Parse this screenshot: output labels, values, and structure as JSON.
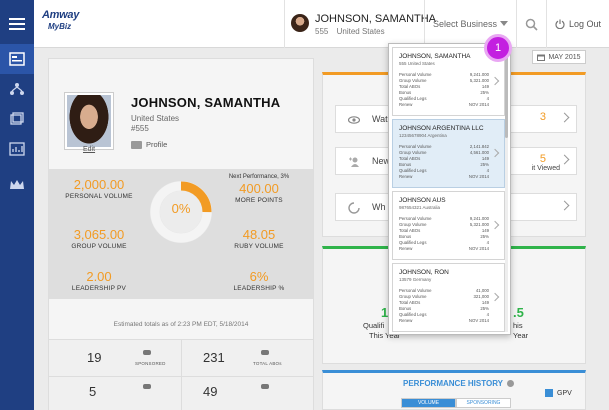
{
  "brand": {
    "name": "Amway",
    "sub": "MyBiz"
  },
  "header": {
    "user_name": "JOHNSON, SAMANTHA",
    "user_num": "555",
    "user_country": "United States",
    "select_business": "Select Business",
    "logout": "Log Out"
  },
  "date_badge": "MAY 2015",
  "callout": "1",
  "profile": {
    "name": "JOHNSON, SAMANTHA",
    "country": "United States",
    "id": "#555",
    "edit": "Edit",
    "profile_link": "Profile"
  },
  "stats": {
    "personal_volume": {
      "value": "2,000.00",
      "label": "PERSONAL VOLUME"
    },
    "group_volume": {
      "value": "3,065.00",
      "label": "GROUP VOLUME"
    },
    "leadership_pv": {
      "value": "2.00",
      "label": "LEADERSHIP PV"
    },
    "next_performance": "Next Performance, 3%",
    "more_points": {
      "value": "400.00",
      "label": "MORE POINTS"
    },
    "ruby_volume": {
      "value": "48.05",
      "label": "RUBY VOLUME"
    },
    "leadership_pct": {
      "value": "6%",
      "label": "LEADERSHIP %"
    },
    "progress_pct": "0%",
    "progress_fraction": 0.25,
    "estimated": "Estimated totals as of 2:23 PM EDT, 5/18/2014"
  },
  "counts": [
    {
      "value": "19",
      "label": "SPONSORED"
    },
    {
      "value": "231",
      "label": "TOTAL ABOs"
    },
    {
      "value": "5",
      "label": ""
    },
    {
      "value": "49",
      "label": ""
    }
  ],
  "actions": [
    {
      "text": "Wat",
      "value": "3",
      "sub": ""
    },
    {
      "text": "New",
      "value": "5",
      "sub": "it Viewed"
    },
    {
      "text": "Wh",
      "value": "",
      "sub": ""
    }
  ],
  "qualified": {
    "left_value": "1",
    "left_label_1": "Qualifi",
    "left_label_2": "This Year",
    "right_value": ".5",
    "right_label_1": "his",
    "right_label_2": "Year"
  },
  "performance": {
    "title": "PERFORMANCE HISTORY",
    "legend": "GPV",
    "tabs": [
      "VOLUME",
      "SPONSORING"
    ]
  },
  "businesses": [
    {
      "name": "JOHNSON, SAMANTHA",
      "sub": "555      United States",
      "rows": [
        [
          "Personal Volume",
          "9,241.000"
        ],
        [
          "Group Volume",
          "5,321.000"
        ],
        [
          "Total ABOs",
          "149"
        ],
        [
          "Bonus",
          "25%"
        ],
        [
          "Qualified Legs",
          "4"
        ],
        [
          "Renew",
          "NOV 2014"
        ]
      ]
    },
    {
      "name": "JOHNSON ARGENTINA LLC",
      "sub": "12345678904    Argentina",
      "rows": [
        [
          "Personal Volume",
          "2,141.842"
        ],
        [
          "Group Volume",
          "4,561.000"
        ],
        [
          "Total ABOs",
          "149"
        ],
        [
          "Bonus",
          "25%"
        ],
        [
          "Qualified Legs",
          "4"
        ],
        [
          "Renew",
          "NOV 2014"
        ]
      ]
    },
    {
      "name": "JOHNSON AUS",
      "sub": "987654321    Australia",
      "rows": [
        [
          "Personal Volume",
          "9,241.000"
        ],
        [
          "Group Volume",
          "5,321.000"
        ],
        [
          "Total ABOs",
          "149"
        ],
        [
          "Bonus",
          "25%"
        ],
        [
          "Qualified Legs",
          "4"
        ],
        [
          "Renew",
          "NOV 2014"
        ]
      ]
    },
    {
      "name": "JOHNSON, RON",
      "sub": "13579    Germany",
      "rows": [
        [
          "Personal Volume",
          "41,000"
        ],
        [
          "Group Volume",
          "321,000"
        ],
        [
          "Total ABOs",
          "149"
        ],
        [
          "Bonus",
          "25%"
        ],
        [
          "Qualified Legs",
          "4"
        ],
        [
          "Renew",
          "NOV 2014"
        ]
      ]
    }
  ],
  "colors": {
    "nav": "#1f3f82",
    "accent_orange": "#f29b24",
    "accent_green": "#2fb34a",
    "accent_blue": "#3a8ed6",
    "callout": "#c31fe0"
  }
}
